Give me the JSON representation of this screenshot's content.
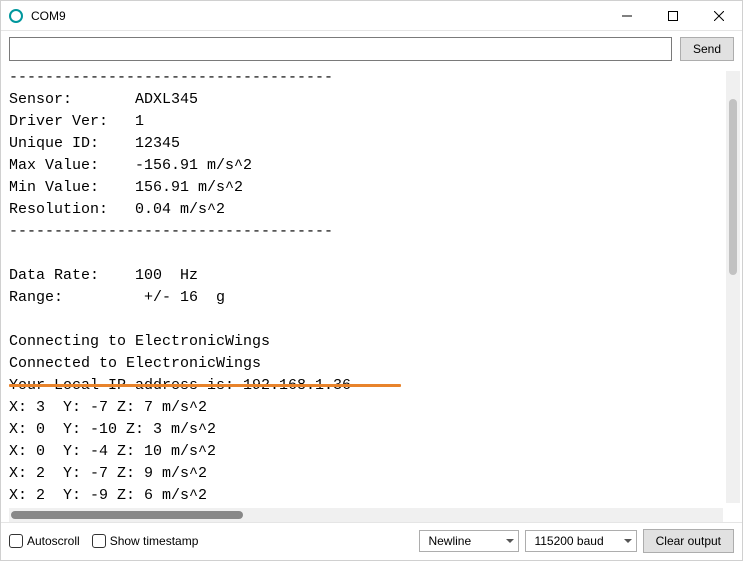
{
  "window": {
    "title": "COM9"
  },
  "send": {
    "input_value": "",
    "button_label": "Send"
  },
  "output_text": "------------------------------------\nSensor:       ADXL345\nDriver Ver:   1\nUnique ID:    12345\nMax Value:    -156.91 m/s^2\nMin Value:    156.91 m/s^2\nResolution:   0.04 m/s^2\n------------------------------------\n\nData Rate:    100  Hz\nRange:         +/- 16  g\n\nConnecting to ElectronicWings\nConnected to ElectronicWings\nYour Local IP address is: 192.168.1.36\nX: 3  Y: -7 Z: 7 m/s^2\nX: 0  Y: -10 Z: 3 m/s^2\nX: 0  Y: -4 Z: 10 m/s^2\nX: 2  Y: -7 Z: 9 m/s^2\nX: 2  Y: -9 Z: 6 m/s^2",
  "bottom": {
    "autoscroll_label": "Autoscroll",
    "timestamp_label": "Show timestamp",
    "line_ending": "Newline",
    "baud": "115200 baud",
    "clear_label": "Clear output"
  },
  "annotation": {
    "underline_target": "Your Local IP address is: 192.168.1.36",
    "underline_color": "#e8832b"
  }
}
